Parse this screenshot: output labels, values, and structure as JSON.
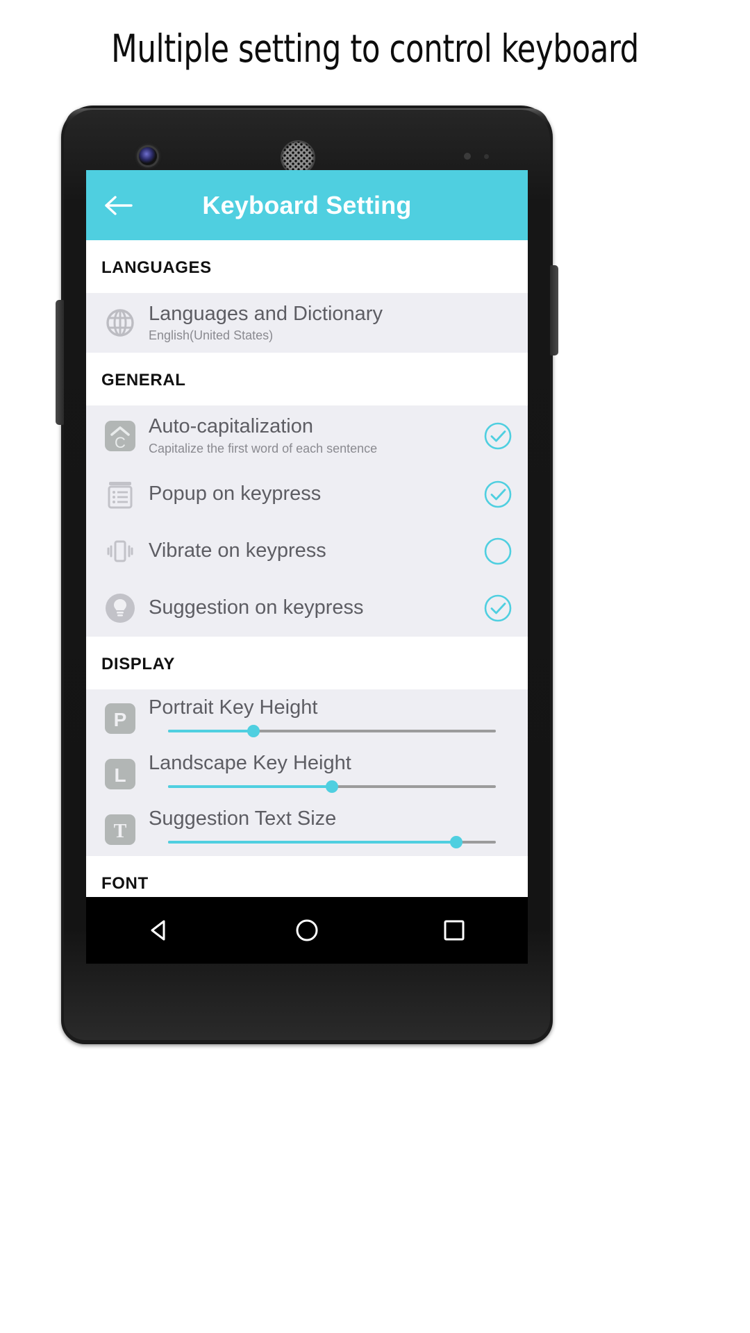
{
  "headline": "Multiple setting to control keyboard",
  "colors": {
    "accent": "#4FCFE0",
    "group_bg": "#EEEEF3",
    "title_text": "#5D5D63",
    "sub_text": "#8A8A90",
    "icon_gray": "#B6B6BB",
    "nav_bg": "#000000"
  },
  "appbar": {
    "back_icon": "arrow-left-icon",
    "title": "Keyboard Setting"
  },
  "sections": [
    {
      "header": "LANGUAGES",
      "rows": [
        {
          "icon": "globe-icon",
          "title": "Languages and Dictionary",
          "sub": "English(United States)",
          "control": "none"
        }
      ]
    },
    {
      "header": "GENERAL",
      "rows": [
        {
          "icon": "auto-capitalization-icon",
          "icon_letter": "C",
          "title": "Auto-capitalization",
          "sub": "Capitalize the first word of each sentence",
          "control": "check",
          "checked": true
        },
        {
          "icon": "popup-keypress-icon",
          "title": "Popup on keypress",
          "sub": "",
          "control": "check",
          "checked": true
        },
        {
          "icon": "vibrate-icon",
          "title": "Vibrate on keypress",
          "sub": "",
          "control": "check",
          "checked": false
        },
        {
          "icon": "suggestion-bulb-icon",
          "title": "Suggestion on keypress",
          "sub": "",
          "control": "check",
          "checked": true
        }
      ]
    },
    {
      "header": "DISPLAY",
      "sliders": [
        {
          "icon": "portrait-key-height-icon",
          "icon_letter": "P",
          "title": "Portrait Key Height",
          "value": 26
        },
        {
          "icon": "landscape-key-height-icon",
          "icon_letter": "L",
          "title": "Landscape Key Height",
          "value": 50
        },
        {
          "icon": "suggestion-text-size-icon",
          "icon_letter": "T",
          "title": "Suggestion Text Size",
          "value": 88
        }
      ]
    },
    {
      "header": "FONT",
      "cut_off": true
    }
  ],
  "navbar": {
    "back": "nav-back-triangle-icon",
    "home": "nav-home-circle-icon",
    "recents": "nav-recents-square-icon"
  }
}
